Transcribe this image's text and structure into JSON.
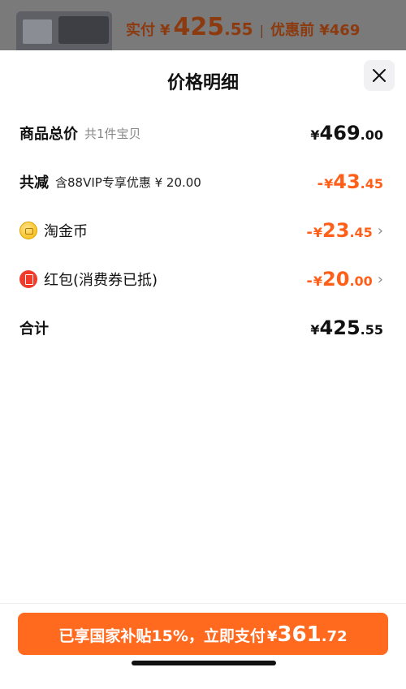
{
  "background": {
    "actual_label": "实付",
    "actual_currency": "¥",
    "actual_int": "425",
    "actual_dec": ".55",
    "separator": "|",
    "original_text": "优惠前 ¥469"
  },
  "sheet": {
    "title": "价格明细"
  },
  "rows": {
    "total": {
      "label": "商品总价",
      "sub": "共1件宝贝",
      "currency": "¥",
      "int": "469",
      "dec": ".00"
    },
    "discount": {
      "label": "共减",
      "sub": "含88VIP专享优惠 ¥ 20.00",
      "sign": "-",
      "currency": "¥",
      "int": "43",
      "dec": ".45"
    },
    "coins": {
      "label": "淘金币",
      "sign": "-",
      "currency": "¥",
      "int": "23",
      "dec": ".45",
      "chevron": "›"
    },
    "redpacket": {
      "label": "红包(消费券已抵)",
      "sign": "-",
      "currency": "¥",
      "int": "20",
      "dec": ".00",
      "chevron": "›"
    },
    "sum": {
      "label": "合计",
      "currency": "¥",
      "int": "425",
      "dec": ".55"
    }
  },
  "pay": {
    "text": "已享国家补贴15%，立即支付",
    "currency": "¥",
    "int": "361",
    "dec": ".72"
  },
  "icons": {
    "close": "close-icon",
    "coin": "taojinbi-coin-icon",
    "redpacket": "red-packet-icon",
    "chevron": "chevron-right-icon"
  },
  "colors": {
    "accent": "#ff6a1f",
    "discount_text": "#ff5f18",
    "text_primary": "#111111",
    "text_secondary": "#888888"
  }
}
